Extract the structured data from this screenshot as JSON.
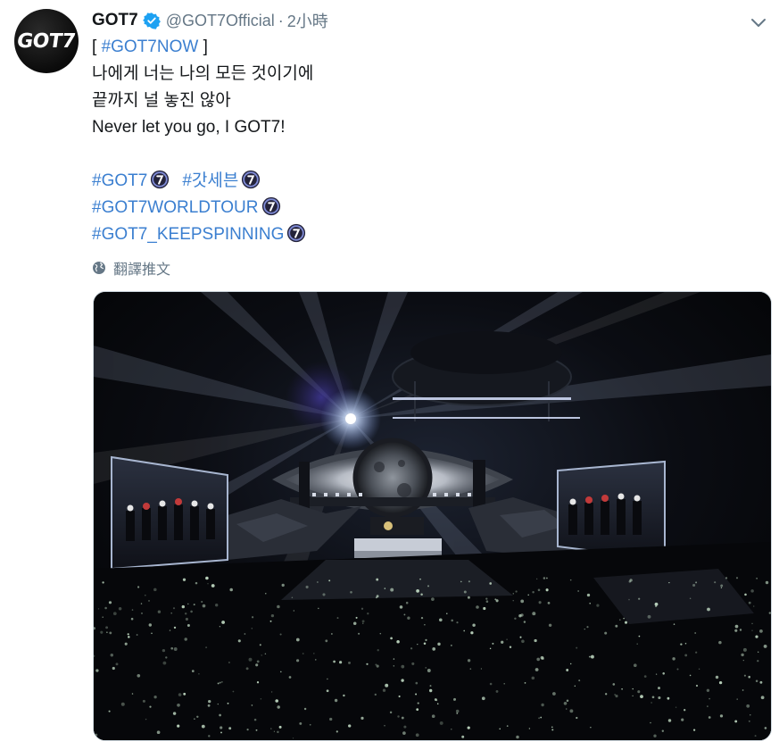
{
  "account": {
    "avatar_text": "GOT7",
    "name": "GOT7",
    "handle": "@GOT7Official",
    "separator": "·",
    "time": "2小時"
  },
  "tweet": {
    "bracket_open": "[",
    "hashtag_now": "#GOT7NOW",
    "bracket_close": "]",
    "line2": "나에게 너는 나의 모든 것이기에",
    "line3": "끝까지 널 놓진 않아",
    "line4": "Never let you go, I GOT7!",
    "hashtag1": "#GOT7",
    "hashtag2": "#갓세븐",
    "hashtag3": "#GOT7WORLDTOUR",
    "hashtag4": "#GOT7_KEEPSPINNING"
  },
  "translate_label": "翻譯推文",
  "icons": {
    "verified": "verified-badge-icon",
    "chevron": "chevron-down-icon",
    "globe": "globe-icon",
    "hashflag": "got7-hashflag-icon"
  },
  "colors": {
    "link": "#3b7fd0",
    "verified": "#1da1f2",
    "muted": "#657786"
  }
}
